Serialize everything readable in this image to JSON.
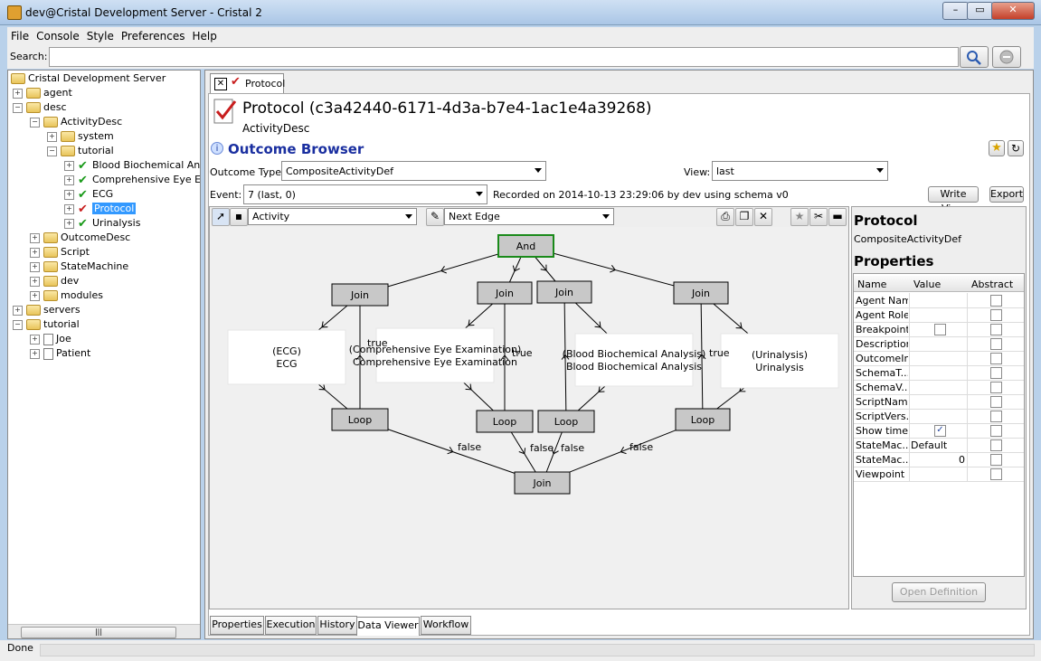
{
  "window": {
    "title": "dev@Cristal Development Server - Cristal 2"
  },
  "menu": [
    "File",
    "Console",
    "Style",
    "Preferences",
    "Help"
  ],
  "search": {
    "label": "Search:",
    "value": ""
  },
  "tree": [
    {
      "label": "Cristal Development Server",
      "level": 0,
      "kind": "folder",
      "toggle": ""
    },
    {
      "label": "agent",
      "level": 1,
      "kind": "folder",
      "toggle": "+"
    },
    {
      "label": "desc",
      "level": 1,
      "kind": "folder",
      "toggle": "-"
    },
    {
      "label": "ActivityDesc",
      "level": 2,
      "kind": "folder",
      "toggle": "-"
    },
    {
      "label": "system",
      "level": 3,
      "kind": "folder",
      "toggle": "+"
    },
    {
      "label": "tutorial",
      "level": 3,
      "kind": "folder",
      "toggle": "-"
    },
    {
      "label": "Blood Biochemical Analysis",
      "level": 4,
      "kind": "check",
      "toggle": "+"
    },
    {
      "label": "Comprehensive Eye Examination",
      "level": 4,
      "kind": "check",
      "toggle": "+"
    },
    {
      "label": "ECG",
      "level": 4,
      "kind": "check",
      "toggle": "+"
    },
    {
      "label": "Protocol",
      "level": 4,
      "kind": "protocol",
      "toggle": "+",
      "selected": true
    },
    {
      "label": "Urinalysis",
      "level": 4,
      "kind": "check",
      "toggle": "+"
    },
    {
      "label": "OutcomeDesc",
      "level": 2,
      "kind": "folder",
      "toggle": "+"
    },
    {
      "label": "Script",
      "level": 2,
      "kind": "folder",
      "toggle": "+"
    },
    {
      "label": "StateMachine",
      "level": 2,
      "kind": "folder",
      "toggle": "+"
    },
    {
      "label": "dev",
      "level": 2,
      "kind": "folder",
      "toggle": "+"
    },
    {
      "label": "modules",
      "level": 2,
      "kind": "folder",
      "toggle": "+"
    },
    {
      "label": "servers",
      "level": 1,
      "kind": "folder",
      "toggle": "+"
    },
    {
      "label": "tutorial",
      "level": 1,
      "kind": "folder",
      "toggle": "-"
    },
    {
      "label": "Joe",
      "level": 2,
      "kind": "doc",
      "toggle": "+"
    },
    {
      "label": "Patient",
      "level": 2,
      "kind": "doc",
      "toggle": "+"
    }
  ],
  "tab": {
    "label": "Protocol"
  },
  "item": {
    "title": "Protocol (c3a42440-6171-4d3a-b7e4-1ac1e4a39268)",
    "type": "ActivityDesc"
  },
  "outcome_browser": {
    "title": "Outcome Browser",
    "outcome_type_label": "Outcome Type:",
    "outcome_type_value": "CompositeActivityDef",
    "view_label": "View:",
    "view_value": "last",
    "event_label": "Event:",
    "event_value": "7 (last, 0)",
    "recorded": "Recorded on 2014-10-13 23:29:06 by dev using schema v0",
    "write_view": "Write View",
    "export": "Export"
  },
  "graph_toolbar": {
    "activity_combo": "Activity",
    "edge_combo": "Next Edge"
  },
  "graph": {
    "nodes": [
      {
        "id": "and",
        "label": "And",
        "kind": "split"
      },
      {
        "id": "join1",
        "label": "Join",
        "kind": "split"
      },
      {
        "id": "join2",
        "label": "Join",
        "kind": "split"
      },
      {
        "id": "join3",
        "label": "Join",
        "kind": "split"
      },
      {
        "id": "join4",
        "label": "Join",
        "kind": "split"
      },
      {
        "id": "ecg",
        "label": "(ECG)",
        "sublabel": "ECG",
        "kind": "activity"
      },
      {
        "id": "eye",
        "label": "(Comprehensive Eye Examination)",
        "sublabel": "Comprehensive Eye Examination",
        "kind": "activity"
      },
      {
        "id": "blood",
        "label": "(Blood Biochemical Analysis)",
        "sublabel": "Blood Biochemical Analysis",
        "kind": "activity"
      },
      {
        "id": "urin",
        "label": "(Urinalysis)",
        "sublabel": "Urinalysis",
        "kind": "activity"
      },
      {
        "id": "loop1",
        "label": "Loop",
        "kind": "split"
      },
      {
        "id": "loop2",
        "label": "Loop",
        "kind": "split"
      },
      {
        "id": "loop3",
        "label": "Loop",
        "kind": "split"
      },
      {
        "id": "loop4",
        "label": "Loop",
        "kind": "split"
      },
      {
        "id": "joinEnd",
        "label": "Join",
        "kind": "split"
      }
    ],
    "edge_labels": {
      "true": "true",
      "false": "false"
    }
  },
  "properties": {
    "title": "Protocol",
    "subtitle": "CompositeActivityDef",
    "header": "Properties",
    "columns": [
      "Name",
      "Value",
      "Abstract"
    ],
    "rows": [
      {
        "name": "Agent Name",
        "value": "",
        "checkbox": false,
        "abstract": false
      },
      {
        "name": "Agent Role",
        "value": "",
        "checkbox": false,
        "abstract": false
      },
      {
        "name": "Breakpoint",
        "value": "",
        "checkbox": true,
        "checked": false,
        "abstract": false
      },
      {
        "name": "Description",
        "value": "",
        "checkbox": false,
        "abstract": false
      },
      {
        "name": "OutcomeInit",
        "value": "",
        "checkbox": false,
        "abstract": false
      },
      {
        "name": "SchemaT...",
        "value": "",
        "checkbox": false,
        "abstract": false
      },
      {
        "name": "SchemaV...",
        "value": "",
        "checkbox": false,
        "abstract": false
      },
      {
        "name": "ScriptName",
        "value": "",
        "checkbox": false,
        "abstract": false
      },
      {
        "name": "ScriptVers...",
        "value": "",
        "checkbox": false,
        "abstract": false
      },
      {
        "name": "Show time",
        "value": "",
        "checkbox": true,
        "checked": true,
        "abstract": false
      },
      {
        "name": "StateMac...",
        "value": "Default",
        "checkbox": false,
        "abstract": false
      },
      {
        "name": "StateMac...",
        "value": "0",
        "checkbox": false,
        "abstract": false,
        "align": "right"
      },
      {
        "name": "Viewpoint",
        "value": "",
        "checkbox": false,
        "abstract": false
      }
    ],
    "open_definition": "Open Definition"
  },
  "bottom_tabs": [
    "Properties",
    "Execution",
    "History",
    "Data Viewer",
    "Workflow"
  ],
  "active_bottom_tab": "Data Viewer",
  "status": "Done",
  "colors": {
    "selection": "#3399ff",
    "and_border": "#1a8a1a",
    "title_blue": "#1a2fa0"
  }
}
